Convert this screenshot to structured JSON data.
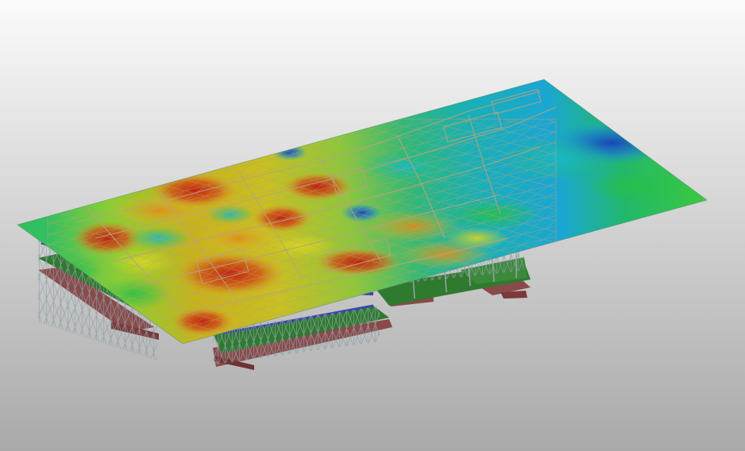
{
  "viewport": {
    "background_top": "#fbfbfb",
    "background_bottom": "#a9a9a9"
  },
  "model": {
    "contour_colors": [
      "#1a3fb8",
      "#18a8d8",
      "#22c07a",
      "#5cc832",
      "#c8d21e",
      "#e0a020",
      "#c42a12"
    ],
    "frame_colors": {
      "slab": "#b9a37a",
      "deck": "#2f7a2f",
      "beams": "#3848a8",
      "footing": "#8a4a4a"
    }
  }
}
